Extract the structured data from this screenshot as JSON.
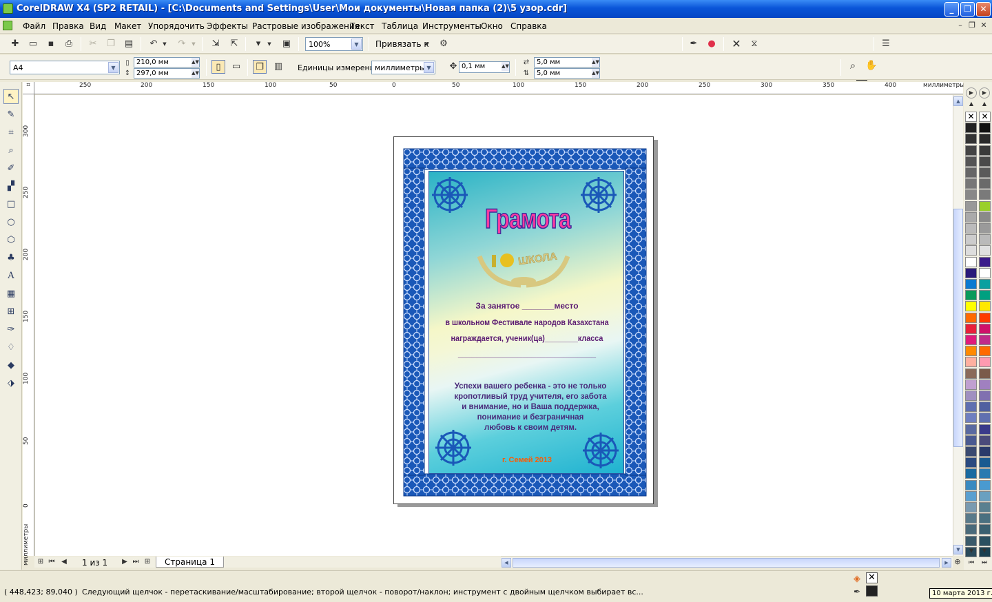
{
  "window": {
    "title": "CorelDRAW X4 (SP2 RETAIL) - [C:\\Documents and Settings\\User\\Мои документы\\Новая папка (2)\\5 узор.cdr]",
    "min_glyph": "_",
    "max_glyph": "❐",
    "close_glyph": "✕"
  },
  "menu": [
    "Файл",
    "Правка",
    "Вид",
    "Макет",
    "Упорядочить",
    "Эффекты",
    "Растровые изображения",
    "Текст",
    "Таблица",
    "Инструменты",
    "Окно",
    "Справка"
  ],
  "mdi": {
    "min": "–",
    "restore": "❐",
    "close": "✕"
  },
  "toolbar": {
    "zoom": "100%",
    "snap_label": "Привязать к",
    "arrow": "▼"
  },
  "propbar": {
    "paper": "A4",
    "width": "210,0 мм",
    "height": "297,0 мм",
    "units_label": "Единицы измерения:",
    "units": "миллиметры",
    "nudge": "0,1 мм",
    "dup_x": "5,0 мм",
    "dup_y": "5,0 мм"
  },
  "ruler": {
    "unit": "миллиметры",
    "h_labels": [
      "250",
      "200",
      "150",
      "100",
      "50",
      "0",
      "50",
      "100",
      "150",
      "200",
      "250",
      "300",
      "350",
      "400"
    ],
    "v_labels": [
      "300",
      "250",
      "200",
      "150",
      "100",
      "50",
      "0"
    ]
  },
  "certificate": {
    "title": "Грамота",
    "logo_text": "ШКОЛА",
    "line1": "За занятое _______место",
    "line2": "в школьном Фестивале народов Казахстана",
    "line3": "награждается, ученик(ца)________класса",
    "line4": "______________________________",
    "para1": "Успехи вашего ребенка - это не только",
    "para2": "кропотливый труд учителя, его забота",
    "para3": "и внимание, но и Ваша поддержка,",
    "para4": "понимание и безграничная",
    "para5": "любовь к своим детям.",
    "footer": "г. Семей 2013"
  },
  "pagebar": {
    "counter": "1 из 1",
    "tab": "Страница 1"
  },
  "status": {
    "coords": "( 448,423; 89,040 )",
    "hint": "Следующий щелчок - перетаскивание/масштабирование; второй щелчок - поворот/наклон; инструмент с двойным щелчком выбирает вс...",
    "date": "10 марта 2013 г."
  },
  "palette_left": [
    "none",
    "#222222",
    "#333333",
    "#444444",
    "#555555",
    "#666666",
    "#777777",
    "#888888",
    "#999999",
    "#aaaaaa",
    "#bbbbbb",
    "#cccccc",
    "#dddddd",
    "#ffffff",
    "#2a1a7a",
    "#0a7ad0",
    "#0a9a5a",
    "#ffff00",
    "#ff6a00",
    "#e8203a",
    "#e01a7a",
    "#ff8a00",
    "#ffb0a0",
    "#8a6a5a",
    "#c0a0d0",
    "#a090c0",
    "#6070b0",
    "#7080c0",
    "#5a6aa0",
    "#4a5a90",
    "#3a4a70",
    "#2a4a80",
    "#1a6aa0",
    "#3a8ac0",
    "#5aa0d0",
    "#7a9ab0",
    "#5a7a8a",
    "#4a6a7a",
    "#3a5a6a",
    "#2a4a5a"
  ],
  "palette_right": [
    "none",
    "#111111",
    "#2a2a2a",
    "#3a3a3a",
    "#4a4a4a",
    "#5a5a5a",
    "#6a6a6a",
    "#7a7a7a",
    "#9ad02a",
    "#8a8a8a",
    "#9a9a9a",
    "#bababa",
    "#e0e0e0",
    "#3a1a8a",
    "#ffffff",
    "#0aa0a0",
    "#00a080",
    "#ffe800",
    "#ff3a00",
    "#d0106a",
    "#c02a8a",
    "#ff6a00",
    "#ff9ab0",
    "#7a5a4a",
    "#a080c0",
    "#8070b0",
    "#5060a0",
    "#6070b0",
    "#3a3a8a",
    "#4a4a7a",
    "#2a3a6a",
    "#1a5a90",
    "#2a7ab0",
    "#4a9ad0",
    "#6aa0c0",
    "#5a8090",
    "#4a7080",
    "#3a6070",
    "#2a5060",
    "#1a4050"
  ],
  "colors": {
    "border_blue": "#1a58b8",
    "title_pink": "#ff3aa0",
    "text_purple": "#5a1a72",
    "footer_orange": "#ff5a00"
  }
}
